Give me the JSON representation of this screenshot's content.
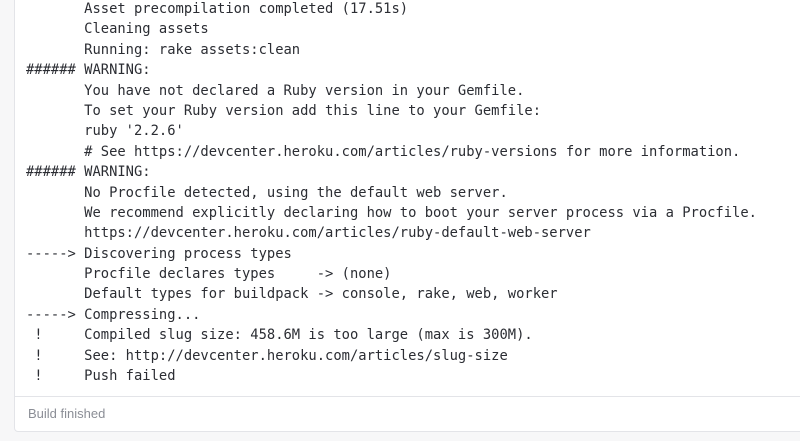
{
  "log_lines": [
    "       Asset precompilation completed (17.51s)",
    "       Cleaning assets",
    "       Running: rake assets:clean",
    "###### WARNING:",
    "       You have not declared a Ruby version in your Gemfile.",
    "       To set your Ruby version add this line to your Gemfile:",
    "       ruby '2.2.6'",
    "       # See https://devcenter.heroku.com/articles/ruby-versions for more information.",
    "###### WARNING:",
    "       No Procfile detected, using the default web server.",
    "       We recommend explicitly declaring how to boot your server process via a Procfile.",
    "       https://devcenter.heroku.com/articles/ruby-default-web-server",
    "-----> Discovering process types",
    "       Procfile declares types     -> (none)",
    "       Default types for buildpack -> console, rake, web, worker",
    "-----> Compressing...",
    " !     Compiled slug size: 458.6M is too large (max is 300M).",
    " !     See: http://devcenter.heroku.com/articles/slug-size",
    " !     Push failed"
  ],
  "footer": {
    "status": "Build finished"
  }
}
